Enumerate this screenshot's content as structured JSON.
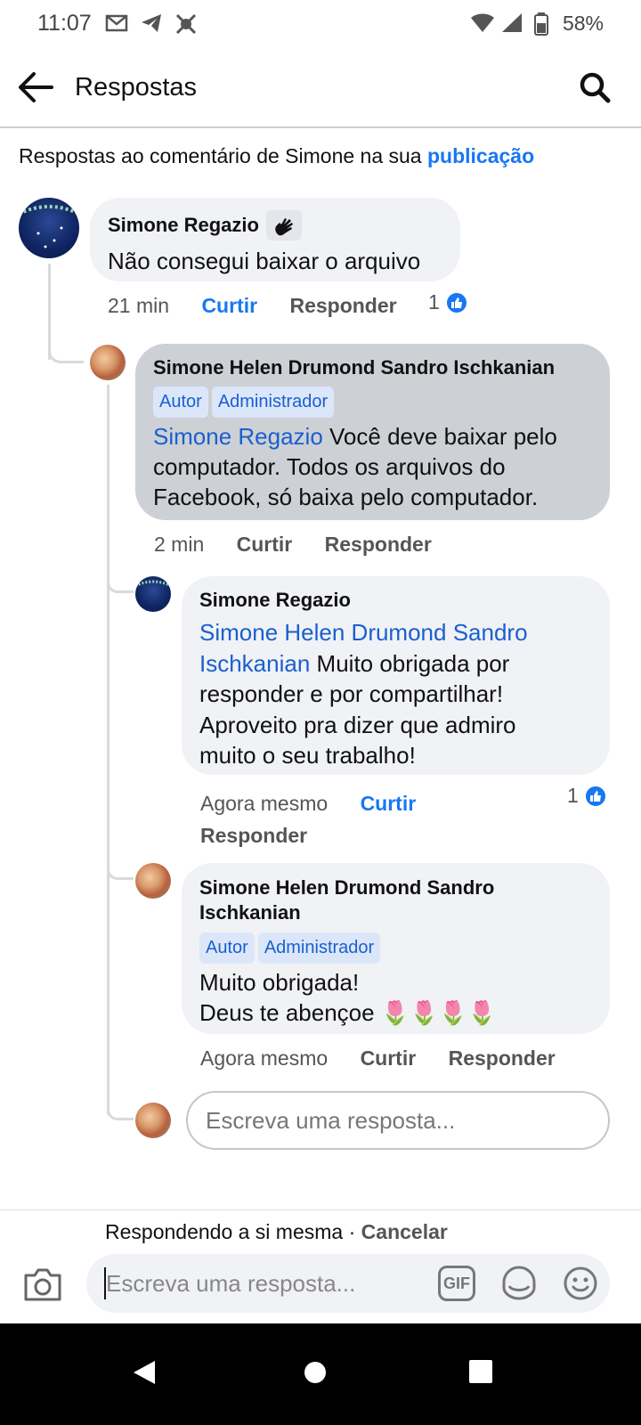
{
  "status_bar": {
    "time": "11:07",
    "battery": "58%"
  },
  "header": {
    "title": "Respostas"
  },
  "context": {
    "prefix": "Respostas ao comentário de Simone na sua",
    "link": "publicação"
  },
  "comments": [
    {
      "name": "Simone Regazio",
      "text": "Não consegui baixar o arquivo",
      "time": "21 min",
      "like": "Curtir",
      "reply": "Responder",
      "reactions": "1"
    },
    {
      "name": "Simone Helen Drumond Sandro Ischkanian",
      "badges": [
        "Autor",
        "Administrador"
      ],
      "mention": "Simone Regazio",
      "text": "Você deve baixar pelo computador. Todos os arquivos do Facebook, só baixa pelo computador.",
      "time": "2 min",
      "like": "Curtir",
      "reply": "Responder"
    },
    {
      "name": "Simone Regazio",
      "mention_line1": "Simone Helen Drumond Sandro",
      "mention_line2": "Ischkanian",
      "text_line2": "Muito obrigada por",
      "text_rest": "responder e por compartilhar! Aproveito pra dizer que admiro muito o seu trabalho!",
      "time": "Agora mesmo",
      "like": "Curtir",
      "reply": "Responder",
      "reactions": "1"
    },
    {
      "name_line1": "Simone Helen Drumond Sandro",
      "name_line2": "Ischkanian",
      "badges": [
        "Autor",
        "Administrador"
      ],
      "text_line1": "Muito obrigada!",
      "text_line2": "Deus te abençoe",
      "emoji": "🌷🌷🌷🌷",
      "time": "Agora mesmo",
      "like": "Curtir",
      "reply": "Responder"
    }
  ],
  "reply_input": {
    "placeholder": "Escreva uma resposta..."
  },
  "composer": {
    "replying_text": "Respondendo a si mesma",
    "separator": "·",
    "cancel": "Cancelar",
    "placeholder": "Escreva uma resposta...",
    "gif_label": "GIF"
  },
  "icons": {
    "status": [
      "gmail-icon",
      "telegram-icon",
      "app-icon",
      "wifi-icon",
      "signal-icon",
      "battery-icon"
    ],
    "nav": [
      "back-triangle-icon",
      "home-circle-icon",
      "recents-square-icon"
    ]
  },
  "colors": {
    "accent": "#1877f2",
    "mention": "#1a5fd0",
    "bubble": "#f0f2f5",
    "highlighted_bubble": "#cdd0d5"
  }
}
